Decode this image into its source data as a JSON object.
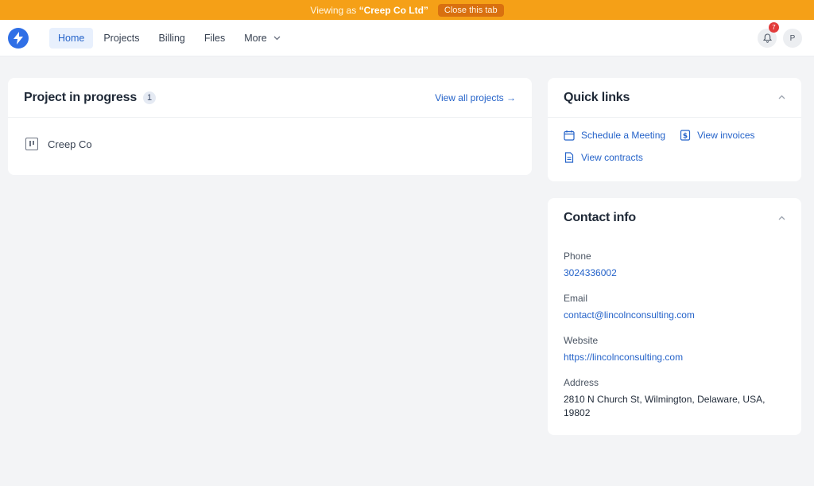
{
  "banner": {
    "prefix": "Viewing as",
    "client": "“Creep Co Ltd”",
    "close_label": "Close this tab"
  },
  "nav": {
    "items": [
      {
        "label": "Home",
        "active": true
      },
      {
        "label": "Projects"
      },
      {
        "label": "Billing"
      },
      {
        "label": "Files"
      },
      {
        "label": "More"
      }
    ],
    "notifications_count": "7",
    "avatar_initial": "P"
  },
  "projects": {
    "title": "Project in progress",
    "count": "1",
    "view_all": "View all projects →",
    "items": [
      {
        "name": "Creep Co"
      }
    ]
  },
  "quick_links": {
    "title": "Quick links",
    "items": [
      {
        "label": "Schedule a Meeting",
        "icon": "calendar-icon"
      },
      {
        "label": "View invoices",
        "icon": "invoice-icon"
      },
      {
        "label": "View contracts",
        "icon": "document-icon"
      }
    ]
  },
  "contact": {
    "title": "Contact info",
    "phone_label": "Phone",
    "phone": "3024336002",
    "email_label": "Email",
    "email": "contact@lincolnconsulting.com",
    "website_label": "Website",
    "website": "https://lincolnconsulting.com",
    "address_label": "Address",
    "address_line1": "2810 N Church St, Wilmington, Delaware, USA,",
    "address_line2": "19802"
  },
  "colors": {
    "banner": "#f5a017",
    "accent": "#2563c9",
    "background": "#f3f4f6"
  }
}
